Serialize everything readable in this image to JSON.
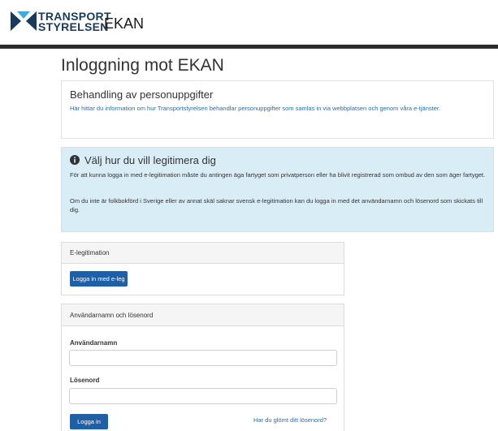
{
  "header": {
    "logo_line1": "TRANSPORT",
    "logo_line2": "STYRELSEN",
    "app_name": "EKAN"
  },
  "main": {
    "title": "Inloggning mot EKAN"
  },
  "privacy": {
    "title": "Behandling av personuppgifter",
    "link_text": "Här hittar du information om hur Transportstyrelsen behandlar personuppgifter som samlas in via webbplatsen och genom våra e-tjänster."
  },
  "alert": {
    "icon": "info-circle-icon",
    "title": "Välj hur du vill legitimera dig",
    "paragraph1": "För att kunna logga in med e-legitimation måste du antingen äga fartyget som privatperson eller ha blivit registrerad som ombud av den som äger fartyget.",
    "paragraph2": "Om du inte är folkbokförd i Sverige eller av annat skäl saknar svensk e-legitimation kan du logga in med det användarnamn och lösenord som skickats till dig."
  },
  "eleg_panel": {
    "heading": "E-legitimation",
    "button_label": "Logga in med e-leg"
  },
  "login_panel": {
    "heading": "Användarnamn och lösenord",
    "username_label": "Användarnamn",
    "username_value": "",
    "password_label": "Lösenord",
    "password_value": "",
    "login_button": "Logga in",
    "forgot_link": "Har du glömt ditt lösenord?"
  },
  "colors": {
    "brand_blue": "#1f5fa6",
    "link_blue": "#2a6db0",
    "alert_bg": "#d9edf7",
    "header_bar": "#2b2b2b",
    "logo_navy": "#1a3a5c"
  }
}
